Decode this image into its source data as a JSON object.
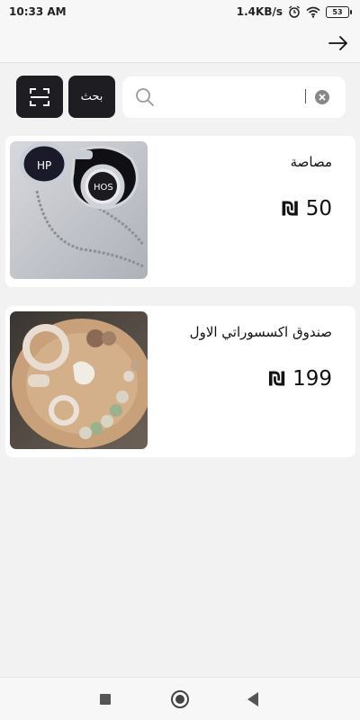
{
  "status_bar": {
    "time": "10:33 AM",
    "network_speed": "1.4KB/s",
    "battery": "53",
    "icons": [
      "alarm-icon",
      "wifi-icon",
      "battery-icon"
    ]
  },
  "header": {
    "back_icon": "arrow-right-icon"
  },
  "search": {
    "button_label": "بحث",
    "input_value": "",
    "placeholder": "",
    "scan_icon": "scan-icon",
    "search_icon": "search-icon",
    "clear_icon": "clear-icon"
  },
  "products": [
    {
      "title": "مصاصة",
      "price": "50",
      "currency": "₪",
      "image": "pacifier-photo"
    },
    {
      "title": "صندوق اكسسوراتي الاول",
      "price": "199",
      "currency": "₪",
      "image": "baby-accessories-photo"
    }
  ],
  "colors": {
    "button_dark": "#1d1d22",
    "background": "#f2f2f2",
    "card": "#ffffff"
  },
  "nav_bar": {
    "icons": [
      "recent-apps-icon",
      "home-icon",
      "back-icon"
    ]
  }
}
